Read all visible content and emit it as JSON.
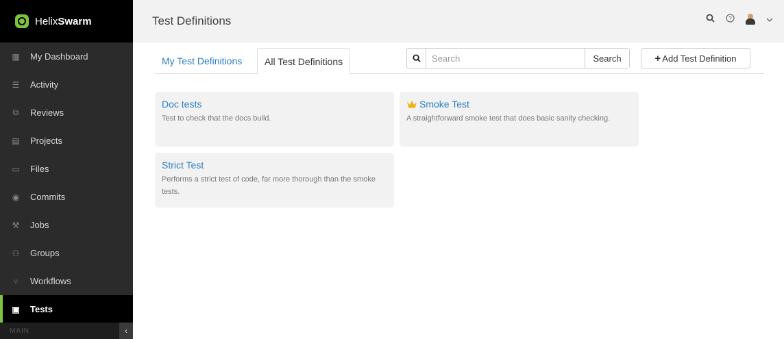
{
  "app": {
    "brand_light": "Helix",
    "brand_bold": "Swarm",
    "accent_color": "#7ec23f"
  },
  "sidebar": {
    "items": [
      {
        "label": "My Dashboard",
        "icon": "dashboard-icon"
      },
      {
        "label": "Activity",
        "icon": "activity-icon"
      },
      {
        "label": "Reviews",
        "icon": "reviews-icon"
      },
      {
        "label": "Projects",
        "icon": "projects-icon"
      },
      {
        "label": "Files",
        "icon": "folder-icon"
      },
      {
        "label": "Commits",
        "icon": "commit-icon"
      },
      {
        "label": "Jobs",
        "icon": "wrench-icon"
      },
      {
        "label": "Groups",
        "icon": "groups-icon"
      },
      {
        "label": "Workflows",
        "icon": "workflow-icon"
      },
      {
        "label": "Tests",
        "icon": "clipboard-icon"
      }
    ],
    "footer_label": "MAIN"
  },
  "header": {
    "title": "Test Definitions"
  },
  "tabs": [
    {
      "label": "My Test Definitions"
    },
    {
      "label": "All Test Definitions"
    }
  ],
  "search": {
    "placeholder": "Search",
    "button_label": "Search"
  },
  "add_button": {
    "label": "Add Test Definition"
  },
  "cards": [
    {
      "title": "Doc tests",
      "description": "Test to check that the docs build."
    },
    {
      "title": "Smoke Test",
      "description": "A straightforward smoke test that does basic sanity checking.",
      "icon": "crown-icon"
    },
    {
      "title": "Strict Test",
      "description": "Performs a strict test of code, far more thorough than the smoke tests."
    }
  ]
}
